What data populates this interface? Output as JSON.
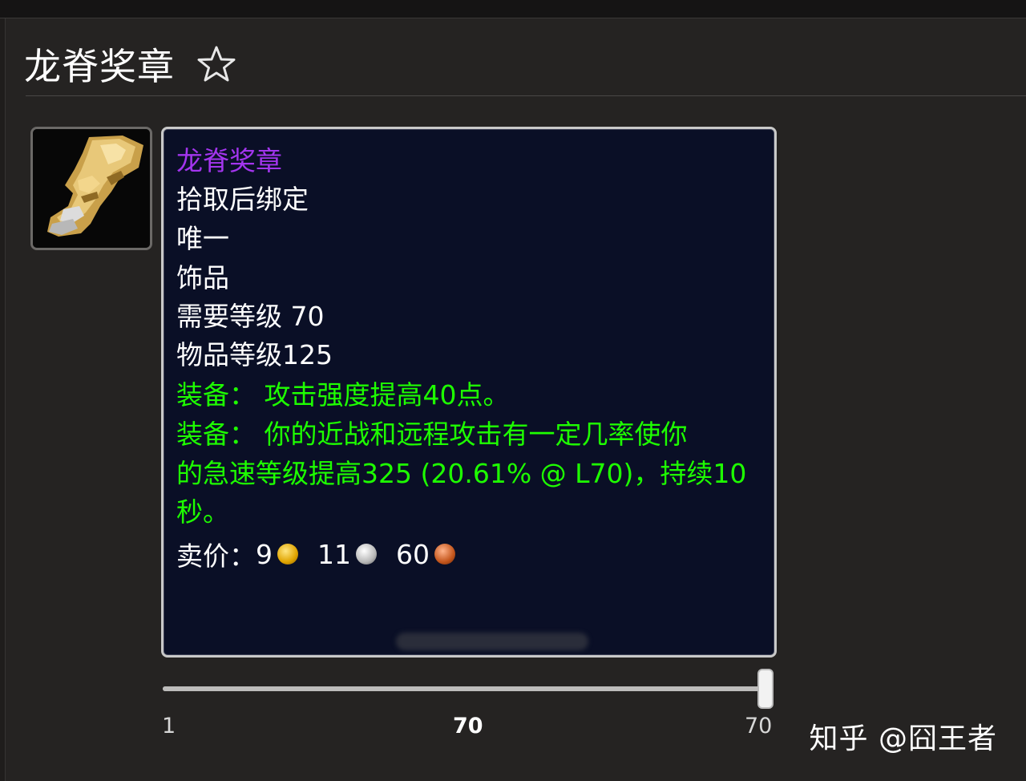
{
  "header": {
    "title": "龙脊奖章",
    "favorite_icon": "star-outline-icon"
  },
  "item": {
    "icon": "trinket-armored-leg-icon",
    "name": "龙脊奖章",
    "name_color": "#a335ee",
    "lines": {
      "bind": "拾取后绑定",
      "unique": "唯一",
      "slot": "饰品",
      "req_level": "需要等级 70",
      "item_level": "物品等级125",
      "equip1": "装备：   攻击强度提高40点。",
      "equip2_a": "装备：   你的近战和远程攻击有一定几率使你",
      "equip2_b": "的急速等级提高325 (20.61% @ L70)，持续10",
      "equip2_c": "秒。"
    },
    "sell_price": {
      "label": "卖价：",
      "gold": "9",
      "silver": "11",
      "copper": "60"
    }
  },
  "level_slider": {
    "min_label": "1",
    "current_label": "70",
    "max_label": "70",
    "min": 1,
    "max": 70,
    "value": 70
  },
  "watermark": "知乎 @囧王者",
  "colors": {
    "epic": "#a335ee",
    "equip_green": "#1eff00",
    "tooltip_bg": "#0a0f26"
  }
}
